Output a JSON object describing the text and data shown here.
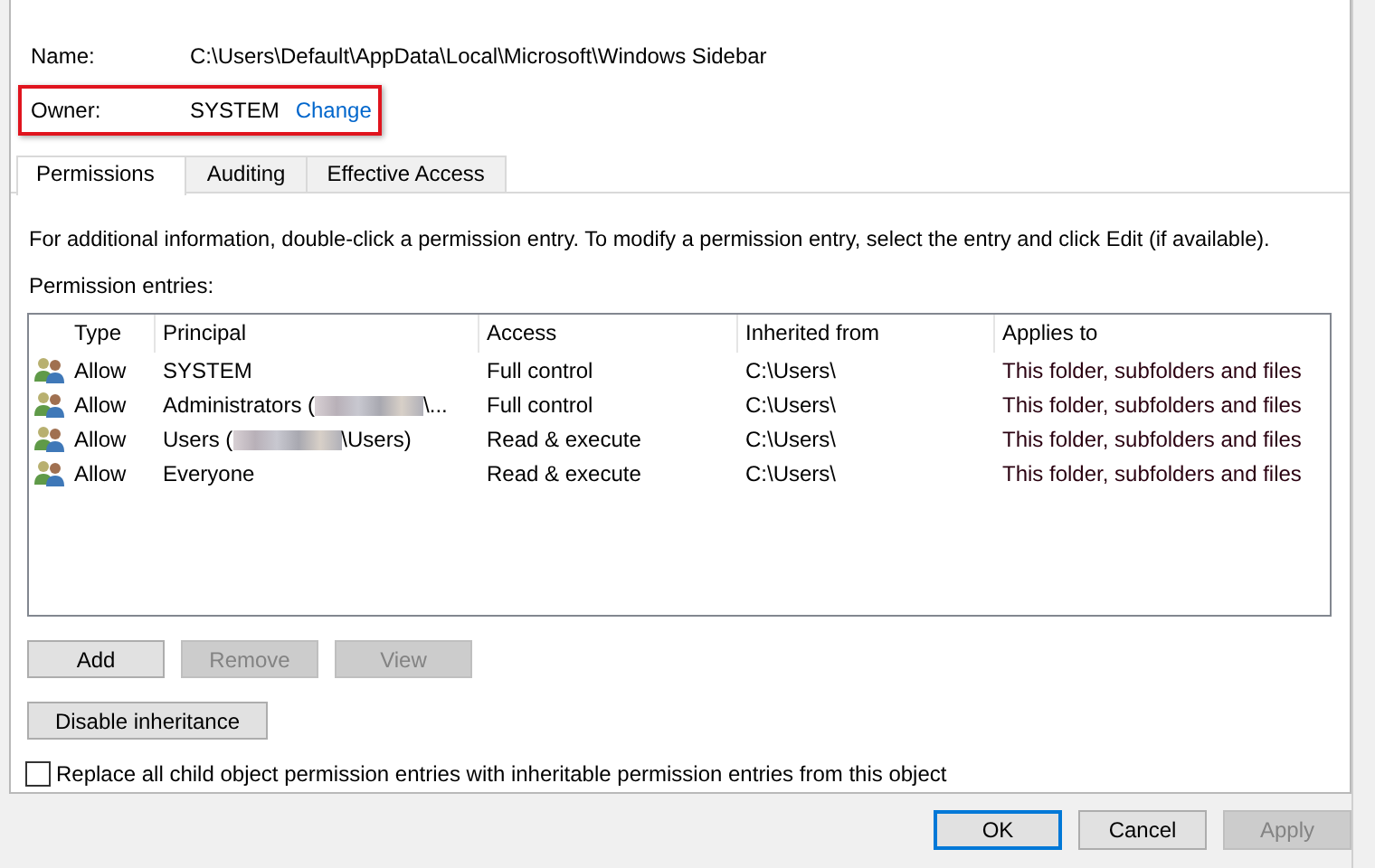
{
  "fields": [
    {
      "label": "Name:",
      "value": "C:\\Users\\Default\\AppData\\Local\\Microsoft\\Windows Sidebar",
      "highlighted": false
    },
    {
      "label": "Owner:",
      "value": "SYSTEM",
      "link": "Change",
      "highlighted": true
    }
  ],
  "tabs": [
    {
      "label": "Permissions",
      "selected": true
    },
    {
      "label": "Auditing",
      "selected": false
    },
    {
      "label": "Effective Access",
      "selected": false
    }
  ],
  "info": "For additional information, double-click a permission entry. To modify a permission entry, select the entry and click Edit (if available).",
  "entries_label": "Permission entries:",
  "table": {
    "columns": [
      "Type",
      "Principal",
      "Access",
      "Inherited from",
      "Applies to"
    ],
    "rows": [
      {
        "type": "Allow",
        "principal": "SYSTEM",
        "redacted": false,
        "access": "Full control",
        "inherited_from": "C:\\Users\\",
        "applies_to": "This folder, subfolders and files"
      },
      {
        "type": "Allow",
        "principal": "Administrators (",
        "redacted": true,
        "principal_end": "\\...",
        "access": "Full control",
        "inherited_from": "C:\\Users\\",
        "applies_to": "This folder, subfolders and files"
      },
      {
        "type": "Allow",
        "principal": "Users (",
        "redacted": true,
        "principal_end": "\\Users)",
        "access": "Read & execute",
        "inherited_from": "C:\\Users\\",
        "applies_to": "This folder, subfolders and files"
      },
      {
        "type": "Allow",
        "principal": "Everyone",
        "redacted": false,
        "access": "Read & execute",
        "inherited_from": "C:\\Users\\",
        "applies_to": "This folder, subfolders and files"
      }
    ]
  },
  "entry_buttons": [
    {
      "label": "Add",
      "disabled": false
    },
    {
      "label": "Remove",
      "disabled": true
    },
    {
      "label": "View",
      "disabled": true
    }
  ],
  "inheritance_button": {
    "label": "Disable inheritance",
    "disabled": false
  },
  "replace_checkbox": {
    "label": "Replace all child object permission entries with inheritable permission entries from this object",
    "checked": false
  },
  "dialog_buttons": [
    {
      "label": "OK",
      "disabled": false,
      "default": true
    },
    {
      "label": "Cancel",
      "disabled": false,
      "default": false
    },
    {
      "label": "Apply",
      "disabled": true,
      "default": false
    }
  ]
}
